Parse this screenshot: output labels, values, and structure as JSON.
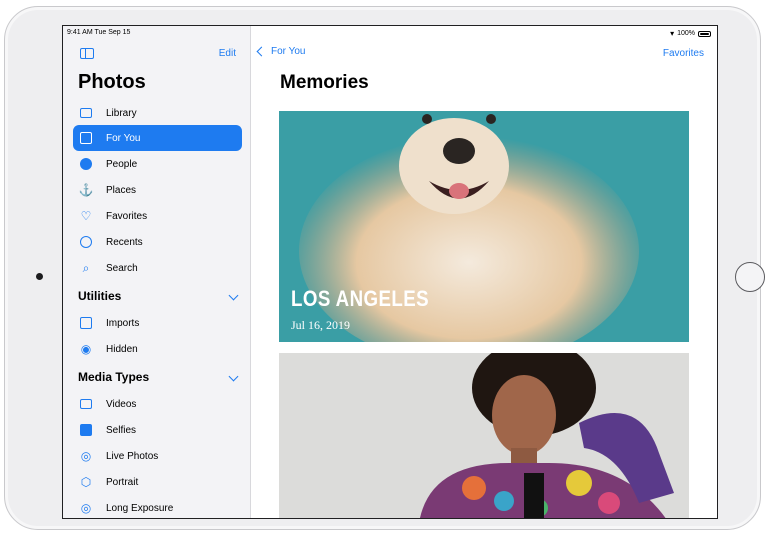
{
  "status_bar": {
    "time": "9:41 AM  Tue Sep 15",
    "battery": "100%"
  },
  "sidebar": {
    "edit_label": "Edit",
    "title": "Photos",
    "items": [
      {
        "label": "Library",
        "icon": "photo-stack-icon"
      },
      {
        "label": "For You",
        "icon": "for-you-icon",
        "selected": true
      },
      {
        "label": "People",
        "icon": "person-circle-icon"
      },
      {
        "label": "Places",
        "icon": "pin-icon"
      },
      {
        "label": "Favorites",
        "icon": "heart-icon"
      },
      {
        "label": "Recents",
        "icon": "clock-icon"
      },
      {
        "label": "Search",
        "icon": "search-icon"
      }
    ],
    "utilities": {
      "header": "Utilities",
      "items": [
        {
          "label": "Imports",
          "icon": "import-icon"
        },
        {
          "label": "Hidden",
          "icon": "eye-slash-icon"
        }
      ]
    },
    "media_types": {
      "header": "Media Types",
      "items": [
        {
          "label": "Videos",
          "icon": "video-icon"
        },
        {
          "label": "Selfies",
          "icon": "selfie-icon"
        },
        {
          "label": "Live Photos",
          "icon": "live-photo-icon"
        },
        {
          "label": "Portrait",
          "icon": "cube-icon"
        },
        {
          "label": "Long Exposure",
          "icon": "long-exposure-icon"
        }
      ]
    }
  },
  "main": {
    "back_label": "For You",
    "favorites_label": "Favorites",
    "title": "Memories",
    "cards": [
      {
        "title": "LOS ANGELES",
        "date": "Jul 16, 2019"
      },
      {
        "title": "",
        "date": ""
      }
    ]
  },
  "colors": {
    "accent": "#1e7bf0",
    "sidebar_bg": "#f3f3f6",
    "card1_bg": "#3ea0a6"
  }
}
